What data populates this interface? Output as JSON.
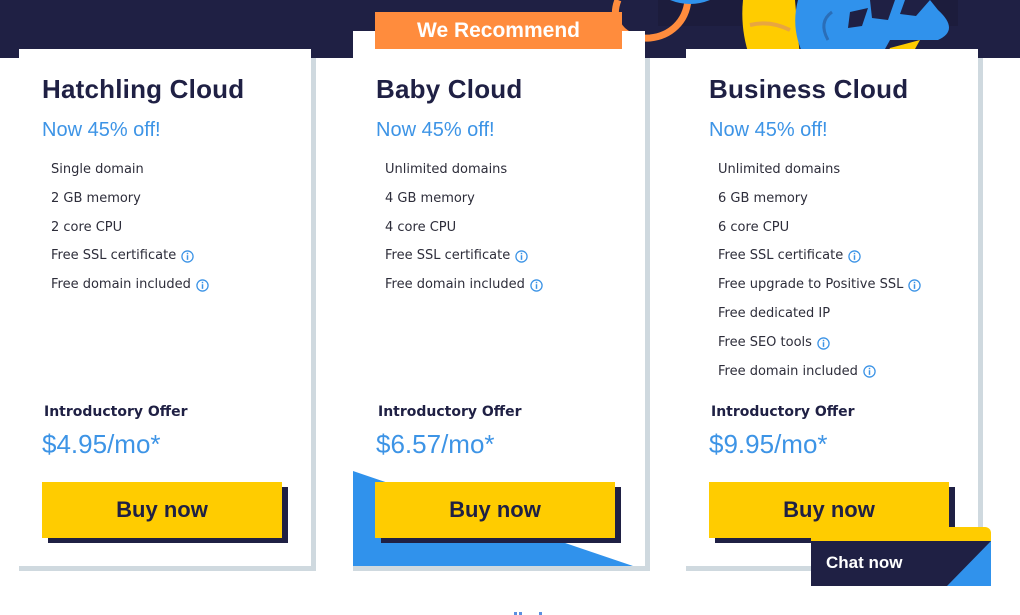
{
  "recommend_badge": "We Recommend",
  "plans": [
    {
      "title": "Hatchling Cloud",
      "discount": "Now 45% off!",
      "features": [
        {
          "text": "Single domain",
          "info": false
        },
        {
          "text": "2 GB memory",
          "info": false
        },
        {
          "text": "2 core CPU",
          "info": false
        },
        {
          "text": "Free SSL certificate",
          "info": true
        },
        {
          "text": "Free domain included",
          "info": true
        }
      ],
      "intro_label": "Introductory Offer",
      "price": "$4.95/mo*",
      "buy_label": "Buy now"
    },
    {
      "title": "Baby Cloud",
      "discount": "Now 45% off!",
      "features": [
        {
          "text": "Unlimited domains",
          "info": false
        },
        {
          "text": "4 GB memory",
          "info": false
        },
        {
          "text": "4 core CPU",
          "info": false
        },
        {
          "text": "Free SSL certificate",
          "info": true
        },
        {
          "text": "Free domain included",
          "info": true
        }
      ],
      "intro_label": "Introductory Offer",
      "price": "$6.57/mo*",
      "buy_label": "Buy now",
      "recommended": true
    },
    {
      "title": "Business Cloud",
      "discount": "Now 45% off!",
      "features": [
        {
          "text": "Unlimited domains",
          "info": false
        },
        {
          "text": "6 GB memory",
          "info": false
        },
        {
          "text": "6 core CPU",
          "info": false
        },
        {
          "text": "Free SSL certificate",
          "info": true
        },
        {
          "text": "Free upgrade to Positive SSL",
          "info": true
        },
        {
          "text": "Free dedicated IP",
          "info": false
        },
        {
          "text": "Free SEO tools",
          "info": true
        },
        {
          "text": "Free domain included",
          "info": true
        }
      ],
      "intro_label": "Introductory Offer",
      "price": "$9.95/mo*",
      "buy_label": "Buy now"
    }
  ],
  "chat": {
    "label": "Chat now"
  },
  "icons": {
    "info": "info-circle-icon"
  },
  "colors": {
    "navy": "#1f2044",
    "accent_blue": "#3d94e6",
    "yellow": "#ffcc00",
    "orange": "#ff8c3d",
    "card_shadow": "#cfd9df",
    "bright_blue": "#3092ec"
  }
}
